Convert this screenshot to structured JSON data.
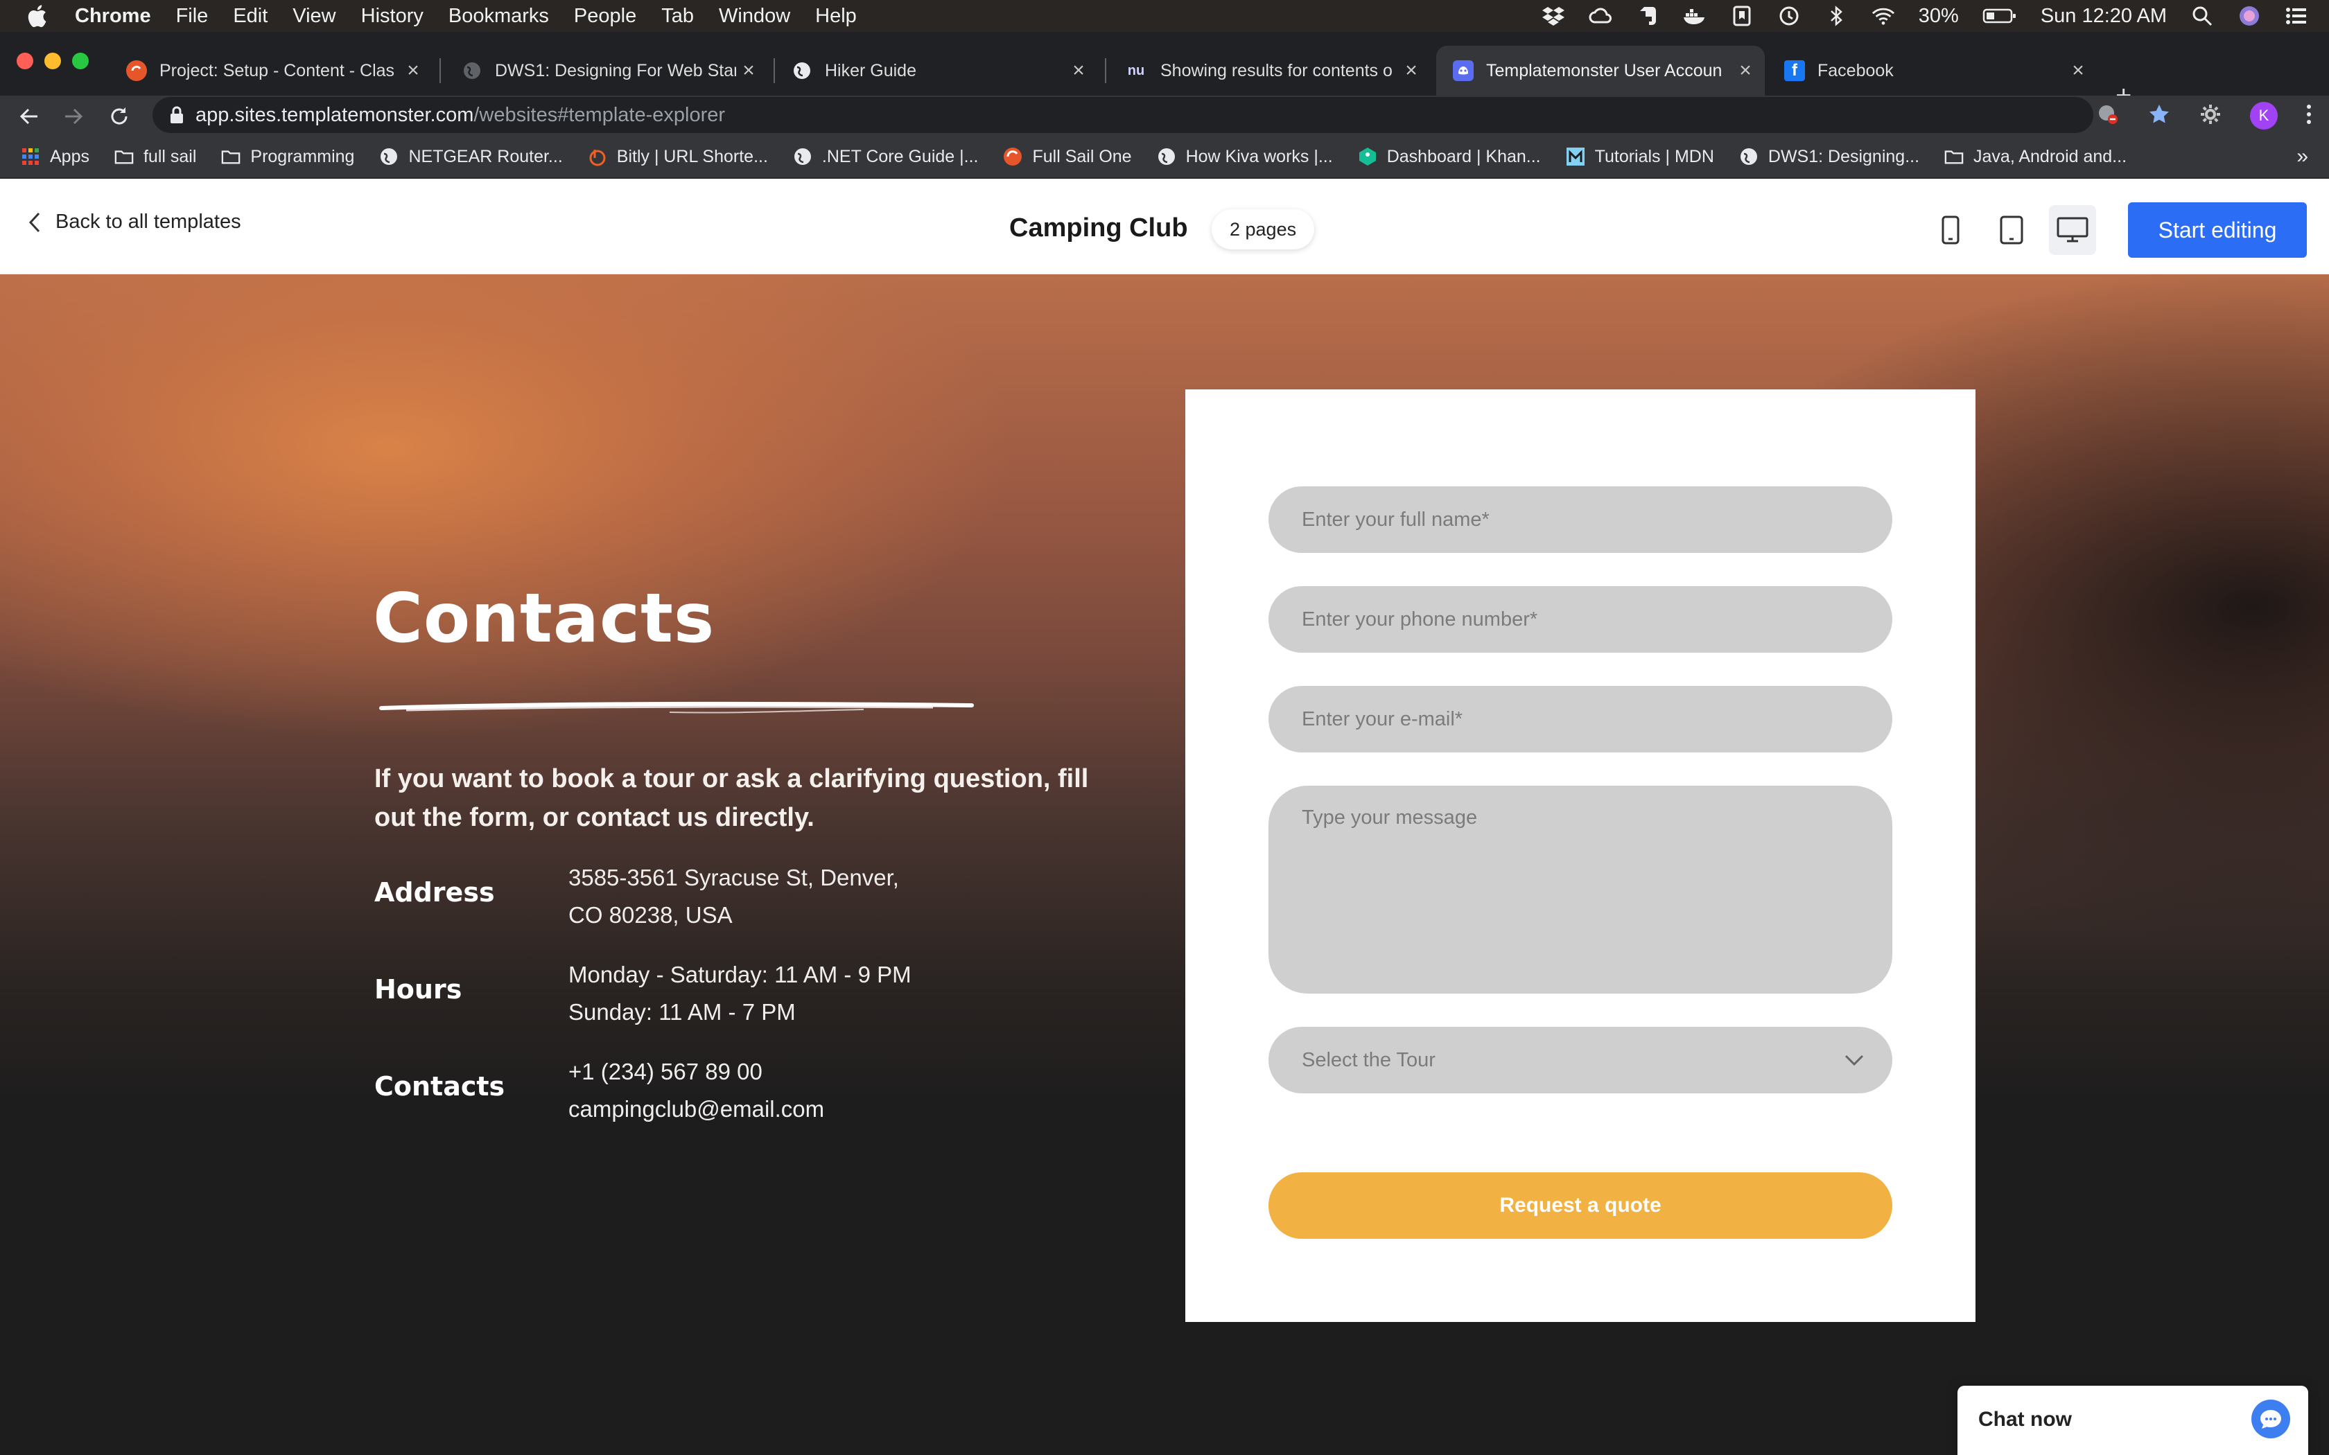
{
  "menubar": {
    "app": "Chrome",
    "items": [
      "File",
      "Edit",
      "View",
      "History",
      "Bookmarks",
      "People",
      "Tab",
      "Window",
      "Help"
    ],
    "battery": "30%",
    "clock": "Sun 12:20 AM"
  },
  "tabs": [
    {
      "title": "Project: Setup - Content - Clas",
      "icon": "course-icon",
      "active": false
    },
    {
      "title": "DWS1: Designing For Web Stan",
      "icon": "globe-icon",
      "active": false
    },
    {
      "title": "Hiker Guide",
      "icon": "globe-icon",
      "active": false
    },
    {
      "title": "Showing results for contents o",
      "icon": "nu-icon",
      "active": false
    },
    {
      "title": "Templatemonster User Accoun",
      "icon": "templatemonster-icon",
      "active": true
    },
    {
      "title": "Facebook",
      "icon": "facebook-icon",
      "active": false
    }
  ],
  "address": {
    "host": "app.sites.templatemonster.com",
    "path": "/websites#template-explorer"
  },
  "toolbar": {
    "avatar_letter": "K"
  },
  "bookmarks": [
    {
      "label": "Apps",
      "icon": "apps-grid-icon"
    },
    {
      "label": "full sail",
      "icon": "folder-icon"
    },
    {
      "label": "Programming",
      "icon": "folder-icon"
    },
    {
      "label": "NETGEAR Router...",
      "icon": "globe-icon"
    },
    {
      "label": "Bitly | URL Shorte...",
      "icon": "bitly-icon"
    },
    {
      "label": ".NET Core Guide |...",
      "icon": "globe-icon"
    },
    {
      "label": "Full Sail One",
      "icon": "course-icon"
    },
    {
      "label": "How Kiva works |...",
      "icon": "globe-icon"
    },
    {
      "label": "Dashboard | Khan...",
      "icon": "khan-icon"
    },
    {
      "label": "Tutorials | MDN",
      "icon": "mdn-icon"
    },
    {
      "label": "DWS1: Designing...",
      "icon": "globe-icon"
    },
    {
      "label": "Java, Android and...",
      "icon": "folder-icon"
    }
  ],
  "editor": {
    "back_label": "Back to all templates",
    "site_title": "Camping Club",
    "pages_label": "2 pages",
    "start_label": "Start editing"
  },
  "contacts": {
    "title": "Contacts",
    "intro": "If you want to book a tour or ask a clarifying question, fill out the form, or contact us directly.",
    "address_label": "Address",
    "address_line1": "3585-3561 Syracuse St, Denver,",
    "address_line2": "CO 80238, USA",
    "hours_label": "Hours",
    "hours_line1": "Monday - Saturday: 11 AM - 9 PM",
    "hours_line2": "Sunday: 11 AM - 7 PM",
    "contacts_label": "Contacts",
    "phone": "+1 (234) 567 89 00",
    "email": "campingclub@email.com"
  },
  "form": {
    "name_placeholder": "Enter your full name*",
    "phone_placeholder": "Enter your phone number*",
    "email_placeholder": "Enter your e-mail*",
    "message_placeholder": "Type your message",
    "tour_placeholder": "Select the Tour",
    "submit_label": "Request a quote"
  },
  "chat": {
    "label": "Chat now"
  },
  "colors": {
    "accent_blue": "#2b6ef5",
    "quote_button": "#f2b143",
    "field_bg": "#cfcfcf"
  }
}
